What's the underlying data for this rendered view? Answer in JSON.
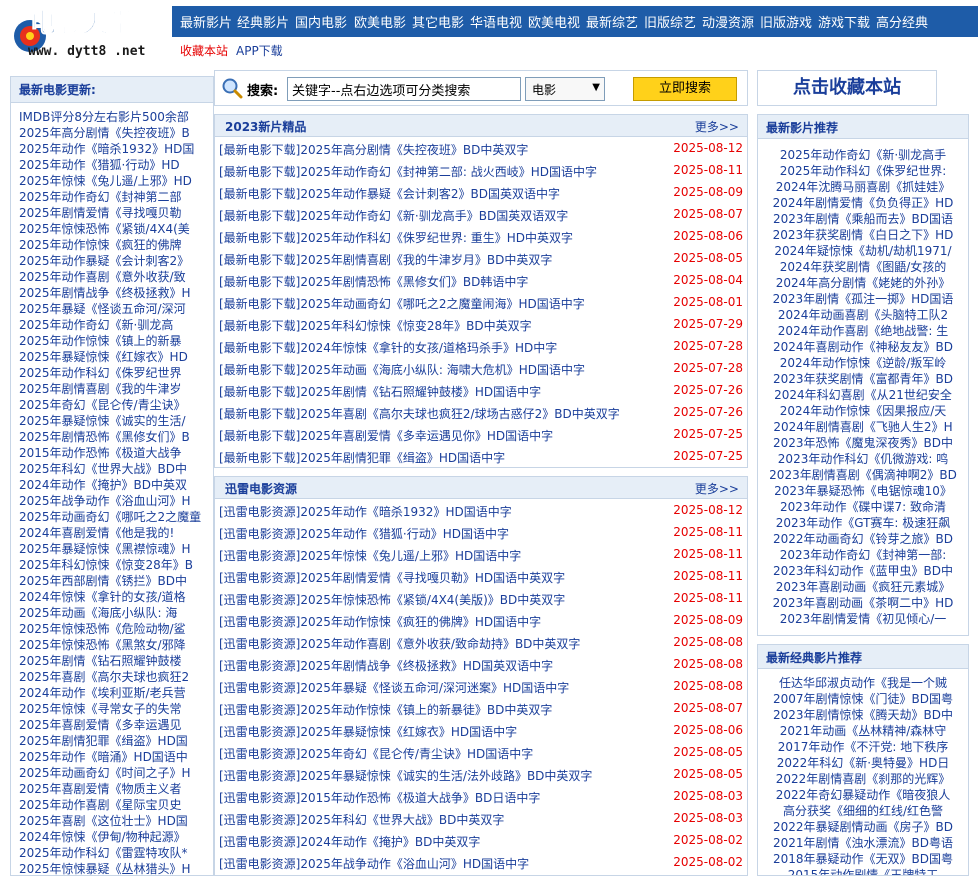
{
  "site": {
    "logo_text": "电影天堂",
    "logo_url": "www. dytt8 .net"
  },
  "nav_main": [
    "最新影片",
    "经典影片",
    "国内电影",
    "欧美电影",
    "其它电影",
    "华语电视",
    "欧美电视",
    "最新综艺",
    "旧版综艺",
    "动漫资源",
    "旧版游戏",
    "游戏下载",
    "高分经典"
  ],
  "nav_sub": [
    "收藏本站",
    "APP下载"
  ],
  "left": {
    "title": "最新电影更新:",
    "items": [
      "IMDB评分8分左右影片500余部",
      "2025年高分剧情《失控夜班》B",
      "2025年动作《暗杀1932》HD国",
      "2025年动作《猎狐·行动》HD",
      "2025年惊悚《兔儿遥/上邪》HD",
      "2025年动作奇幻《封神第二部",
      "2025年剧情爱情《寻找嘎贝勒",
      "2025年惊悚恐怖《紧锁/4X4(美",
      "2025年动作惊悚《疯狂的佛牌",
      "2025年动作暴疑《会计刺客2》",
      "2025年动作喜剧《意外收获/致",
      "2025年剧情战争《终极拯救》H",
      "2025年暴疑《怪谈五命河/深河",
      "2025年动作奇幻《新·驯龙高",
      "2025年动作惊悚《镇上的新暴",
      "2025年暴疑惊悚《红嫁衣》HD",
      "2025年动作科幻《侏罗纪世界",
      "2025年剧情喜剧《我的牛津岁",
      "2025年奇幻《昆仑传/青尘诀》",
      "2025年暴疑惊悚《诚实的生活/",
      "2025年剧情恐怖《黑修女们》B",
      "2015年动作恐怖《极道大战争",
      "2025年科幻《世界大战》BD中",
      "2024年动作《掩护》BD中英双",
      "2025年战争动作《浴血山河》H",
      "2025年动画奇幻《哪吒之2之魔童",
      "2024年喜剧爱情《他是我的!",
      "2025年暴疑惊悚《黑襟惊魂》H",
      "2025年科幻惊悚《惊变28年》B",
      "2025年西部剧情《锈拦》BD中",
      "2024年惊悚《拿针的女孩/道格",
      "2025年动画《海底小纵队: 海",
      "2025年惊悚恐怖《危险动物/鲨",
      "2025年惊悚恐怖《黑煞女/邪降",
      "2025年剧情《钻石照耀钟鼓楼",
      "2025年喜剧《高尔夫球也疯狂2",
      "2024年动作《埃利亚斯/老兵营",
      "2025年惊悚《寻常女子的失常",
      "2025年喜剧爱情《多幸运遇见",
      "2025年剧情犯罪《缉盗》HD国",
      "2025年动作《暗涌》HD国语中",
      "2025年动画奇幻《时间之子》H",
      "2025年喜剧爱情《物质主义者",
      "2025年动作喜剧《星际宝贝史",
      "2025年喜剧《这位壮士》HD国",
      "2024年惊悚《伊甸/物种起源》",
      "2025年动作科幻《雷霆特攻队*",
      "2025年惊悚暴疑《丛林猎头》H"
    ]
  },
  "search": {
    "label": "搜索:",
    "placeholder": "关键字--点右边选项可分类搜索",
    "category": "电影",
    "button": "立即搜索"
  },
  "favorite_button": "点击收藏本站",
  "panel_new": {
    "title": "2023新片精品",
    "more": "更多>>",
    "rows": [
      {
        "title": "[最新电影下载]2025年高分剧情《失控夜班》BD中英双字",
        "date": "2025-08-12"
      },
      {
        "title": "[最新电影下载]2025年动作奇幻《封神第二部: 战火西岐》HD国语中字",
        "date": "2025-08-11"
      },
      {
        "title": "[最新电影下载]2025年动作暴疑《会计刺客2》BD国英双语中字",
        "date": "2025-08-09"
      },
      {
        "title": "[最新电影下载]2025年动作奇幻《新·驯龙高手》BD国英双语双字",
        "date": "2025-08-07"
      },
      {
        "title": "[最新电影下载]2025年动作科幻《侏罗纪世界: 重生》HD中英双字",
        "date": "2025-08-06"
      },
      {
        "title": "[最新电影下载]2025年剧情喜剧《我的牛津岁月》BD中英双字",
        "date": "2025-08-05"
      },
      {
        "title": "[最新电影下载]2025年剧情恐怖《黑修女们》BD韩语中字",
        "date": "2025-08-04"
      },
      {
        "title": "[最新电影下载]2025年动画奇幻《哪吒之2之魔童闹海》HD国语中字",
        "date": "2025-08-01"
      },
      {
        "title": "[最新电影下载]2025年科幻惊悚《惊变28年》BD中英双字",
        "date": "2025-07-29"
      },
      {
        "title": "[最新电影下载]2024年惊悚《拿针的女孩/道格玛杀手》HD中字",
        "date": "2025-07-28"
      },
      {
        "title": "[最新电影下载]2025年动画《海底小纵队: 海啸大危机》HD国语中字",
        "date": "2025-07-28"
      },
      {
        "title": "[最新电影下载]2025年剧情《钻石照耀钟鼓楼》HD国语中字",
        "date": "2025-07-26"
      },
      {
        "title": "[最新电影下载]2025年喜剧《高尔夫球也疯狂2/球场古惑仔2》BD中英双字",
        "date": "2025-07-26"
      },
      {
        "title": "[最新电影下载]2025年喜剧爱情《多幸运遇见你》HD国语中字",
        "date": "2025-07-25"
      },
      {
        "title": "[最新电影下载]2025年剧情犯罪《缉盗》HD国语中字",
        "date": "2025-07-25"
      }
    ]
  },
  "panel_xunlei": {
    "title": "迅雷电影资源",
    "more": "更多>>",
    "rows": [
      {
        "title": "[迅雷电影资源]2025年动作《暗杀1932》HD国语中字",
        "date": "2025-08-12"
      },
      {
        "title": "[迅雷电影资源]2025年动作《猎狐·行动》HD国语中字",
        "date": "2025-08-11"
      },
      {
        "title": "[迅雷电影资源]2025年惊悚《兔儿遥/上邪》HD国语中字",
        "date": "2025-08-11"
      },
      {
        "title": "[迅雷电影资源]2025年剧情爱情《寻找嘎贝勒》HD国语中英双字",
        "date": "2025-08-11"
      },
      {
        "title": "[迅雷电影资源]2025年惊悚恐怖《紧锁/4X4(美版)》BD中英双字",
        "date": "2025-08-11"
      },
      {
        "title": "[迅雷电影资源]2025年动作惊悚《疯狂的佛牌》HD国语中字",
        "date": "2025-08-09"
      },
      {
        "title": "[迅雷电影资源]2025年动作喜剧《意外收获/致命劫持》BD中英双字",
        "date": "2025-08-08"
      },
      {
        "title": "[迅雷电影资源]2025年剧情战争《终极拯救》HD国英双语中字",
        "date": "2025-08-08"
      },
      {
        "title": "[迅雷电影资源]2025年暴疑《怪谈五命河/深河迷案》HD国语中字",
        "date": "2025-08-08"
      },
      {
        "title": "[迅雷电影资源]2025年动作惊悚《镇上的新暴徒》BD中英双字",
        "date": "2025-08-07"
      },
      {
        "title": "[迅雷电影资源]2025年暴疑惊悚《红嫁衣》HD国语中字",
        "date": "2025-08-06"
      },
      {
        "title": "[迅雷电影资源]2025年奇幻《昆仑传/青尘诀》HD国语中字",
        "date": "2025-08-05"
      },
      {
        "title": "[迅雷电影资源]2025年暴疑惊悚《诚实的生活/法外歧路》BD中英双字",
        "date": "2025-08-05"
      },
      {
        "title": "[迅雷电影资源]2015年动作恐怖《极道大战争》BD日语中字",
        "date": "2025-08-03"
      },
      {
        "title": "[迅雷电影资源]2025年科幻《世界大战》BD中英双字",
        "date": "2025-08-03"
      },
      {
        "title": "[迅雷电影资源]2024年动作《掩护》BD中英双字",
        "date": "2025-08-02"
      },
      {
        "title": "[迅雷电影资源]2025年战争动作《浴血山河》HD国语中字",
        "date": "2025-08-02"
      }
    ]
  },
  "right_new": {
    "title": "最新影片推荐",
    "items": [
      "2025年动作奇幻《新·驯龙高手",
      "2025年动作科幻《侏罗纪世界:",
      "2024年沈腾马丽喜剧《抓娃娃》",
      "2024年剧情爱情《负负得正》HD",
      "2023年剧情《乘船而去》BD国语",
      "2023年获奖剧情《白日之下》HD",
      "2024年疑惊悚《劫机/劫机1971/",
      "2024年获奖剧情《图鼯/女孩的",
      "2024年高分剧情《姥姥的外孙》",
      "2023年剧情《孤注一掷》HD国语",
      "2024年动画喜剧《头脑特工队2",
      "2024年动作喜剧《绝地战警: 生",
      "2024年喜剧动作《神秘友友》BD",
      "2024年动作惊悚《逆龄/叛军岭",
      "2023年获奖剧情《富都青年》BD",
      "2024年科幻喜剧《从21世纪安全",
      "2024年动作惊悚《因果报应/天",
      "2024年剧情喜剧《飞驰人生2》H",
      "2023年恐怖《魔鬼深夜秀》BD中",
      "2023年动作科幻《仉微游戏: 鸣",
      "2023年剧情喜剧《偶滴神啊2》BD",
      "2023年暴疑恐怖《电锯惊魂10》",
      "2023年动作《碟中谍7: 致命清",
      "2023年动作《GT赛车: 极速狂飙",
      "2022年动画奇幻《铃芽之旅》BD",
      "2023年动作奇幻《封神第一部:",
      "2023年科幻动作《蓝甲虫》BD中",
      "2023年喜剧动画《疯狂元素城》",
      "2023年喜剧动画《茶啊二中》HD",
      "2023年剧情爱情《初见倾心/一"
    ]
  },
  "right_classic": {
    "title": "最新经典影片推荐",
    "items": [
      "任达华邱淑贞动作《我是一个贼",
      "2007年剧情惊悚《门徒》BD国粤",
      "2023年剧情惊悚《腾天劫》BD中",
      "2021年动画《丛林精神/森林守",
      "2017年动作《不汗党: 地下秩序",
      "2022年科幻《新·奥特曼》HD日",
      "2022年剧情喜剧《刹那的光辉》",
      "2022年奇幻暴疑动作《暗夜狼人",
      "高分获奖《细细的红线/红色警",
      "2022年暴疑剧情动画《房子》BD",
      "2021年剧情《浊水漂流》BD粤语",
      "2018年暴疑动作《无双》BD国粤",
      "2015年动作剧情《王牌特工"
    ]
  }
}
